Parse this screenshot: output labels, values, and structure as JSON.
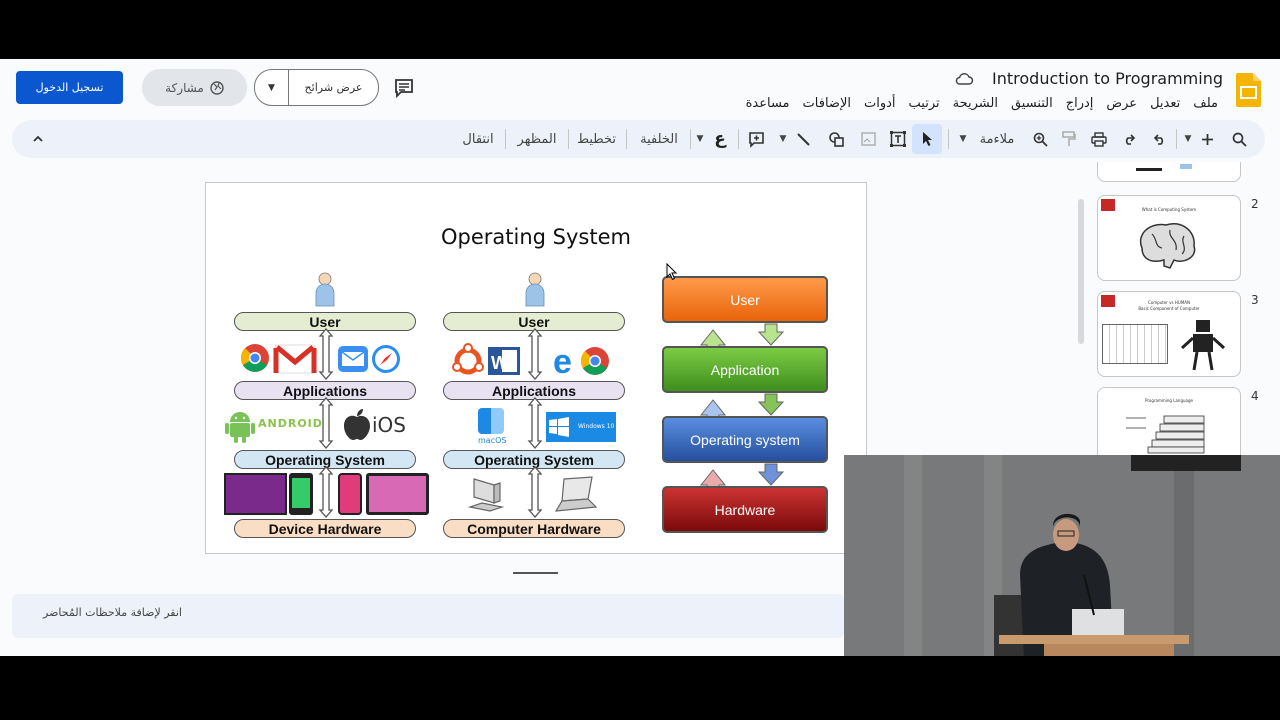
{
  "header": {
    "sign_in": "تسجيل الدخول",
    "share": "مشاركة",
    "slideshow": "عرض شرائح",
    "doc_title": "Introduction to Programming",
    "menu": [
      "ملف",
      "تعديل",
      "عرض",
      "إدراج",
      "التنسيق",
      "الشريحة",
      "ترتيب",
      "أدوات",
      "الإضافات",
      "مساعدة"
    ]
  },
  "toolbar": {
    "fit": "ملاءمة",
    "background": "الخلفية",
    "layout": "تخطيط",
    "theme": "المظهر",
    "transition": "انتقال",
    "text_glyph": "ع"
  },
  "slide": {
    "title": "Operating System",
    "col1": {
      "user": "User",
      "applications": "Applications",
      "android": "ANDROID",
      "ios": "iOS",
      "os": "Operating System",
      "hardware": "Device Hardware"
    },
    "col2": {
      "user": "User",
      "applications": "Applications",
      "macos": "macOS",
      "windows": "Windows 10",
      "os": "Operating System",
      "hardware": "Computer Hardware"
    },
    "stack": [
      "User",
      "Application",
      "Operating system",
      "Hardware"
    ]
  },
  "notes": {
    "placeholder": "انقر لإضافة ملاحظات المُحاضر"
  },
  "filmstrip": {
    "thumbs": [
      {
        "num": "2",
        "title": "What is Computing System"
      },
      {
        "num": "3",
        "title": "Computer vs HUMAN",
        "subtitle": "Basic Component of Computer"
      },
      {
        "num": "4",
        "title": "Programming Language"
      }
    ]
  },
  "colors": {
    "brand_blue": "#0b57d0",
    "user_box": "#f07a1c",
    "app_box": "#5aa82a",
    "os_box": "#3a6cc0",
    "hw_box": "#a01818"
  }
}
